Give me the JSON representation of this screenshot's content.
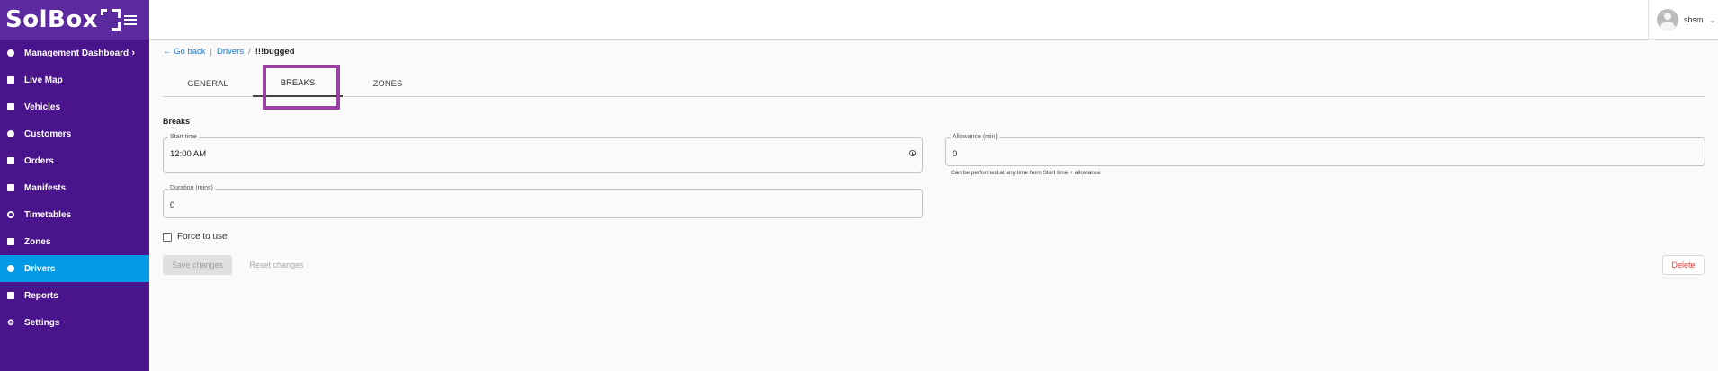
{
  "brand": {
    "name": "SolBox"
  },
  "sidebar": {
    "items": [
      {
        "label": "Management Dashboard",
        "icon": "dashboard-icon"
      },
      {
        "label": "Live Map",
        "icon": "map-icon"
      },
      {
        "label": "Vehicles",
        "icon": "truck-icon"
      },
      {
        "label": "Customers",
        "icon": "person-icon"
      },
      {
        "label": "Orders",
        "icon": "folder-icon"
      },
      {
        "label": "Manifests",
        "icon": "manifest-icon"
      },
      {
        "label": "Timetables",
        "icon": "clock-icon"
      },
      {
        "label": "Zones",
        "icon": "zones-icon"
      },
      {
        "label": "Drivers",
        "icon": "driver-icon",
        "active": true
      },
      {
        "label": "Reports",
        "icon": "reports-icon"
      },
      {
        "label": "Settings",
        "icon": "gear-icon"
      }
    ],
    "active_color": "#039be5",
    "background": "#4a148c"
  },
  "header": {
    "username": "sbsm"
  },
  "breadcrumb": {
    "back": "Go back",
    "parent": "Drivers",
    "current": "!!!bugged"
  },
  "tabs": [
    {
      "label": "GENERAL"
    },
    {
      "label": "BREAKS",
      "active": true
    },
    {
      "label": "ZONES"
    }
  ],
  "breaks": {
    "title": "Breaks",
    "start_time": {
      "label": "Start time",
      "value": "12:00 AM"
    },
    "allowance": {
      "label": "Allowance (min)",
      "value": "0",
      "helper": "Can be performed at any time from Start time + allowance"
    },
    "duration": {
      "label": "Duration (mins)",
      "value": "0"
    },
    "force": {
      "label": "Force to use",
      "checked": false
    }
  },
  "actions": {
    "save": "Save changes",
    "reset": "Reset changes",
    "delete": "Delete"
  }
}
